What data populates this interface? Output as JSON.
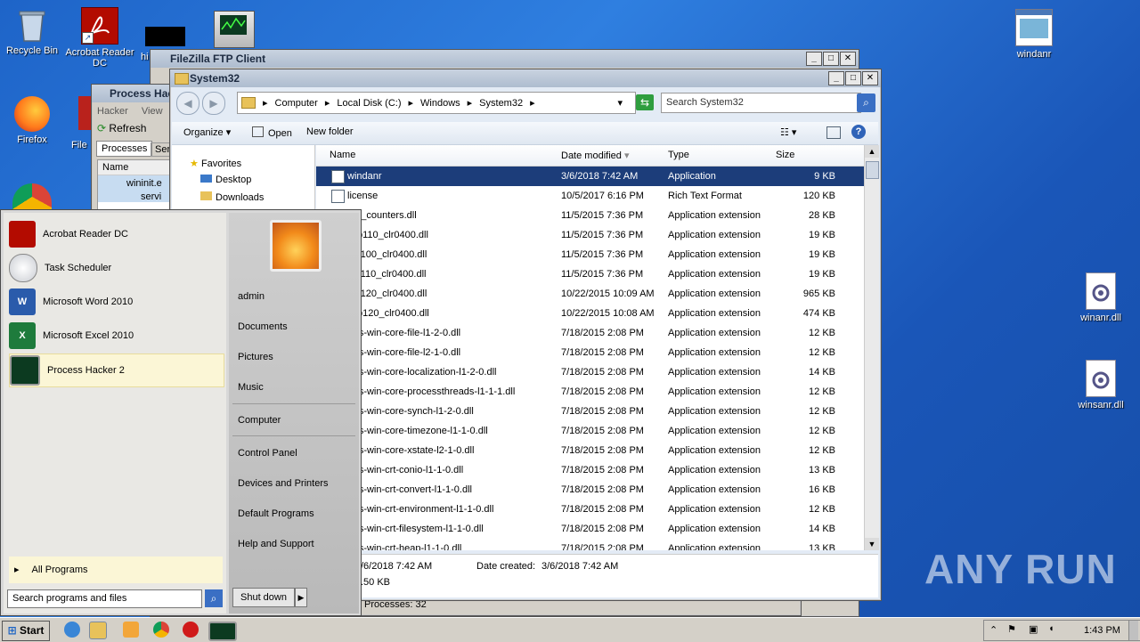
{
  "desktop": {
    "icons": [
      {
        "label": "Recycle Bin"
      },
      {
        "label": "Acrobat Reader DC"
      },
      {
        "label": "Firefox"
      },
      {
        "label": "windanr"
      },
      {
        "label": "winanr.dll"
      },
      {
        "label": "winsanr.dll"
      }
    ],
    "partial_labels": {
      "hi": "hi",
      "filez": "File"
    }
  },
  "filezilla": {
    "title": "FileZilla FTP Client"
  },
  "process_hacker": {
    "title": "Process Hac",
    "menu": [
      "Hacker",
      "View"
    ],
    "refresh": "Refresh",
    "tabs": [
      "Processes",
      "Ser"
    ],
    "column": "Name",
    "tree": [
      "wininit.e",
      "servi"
    ],
    "status": "Processes: 32"
  },
  "explorer": {
    "title": "System32",
    "breadcrumb": [
      "Computer",
      "Local Disk (C:)",
      "Windows",
      "System32"
    ],
    "search_placeholder": "Search System32",
    "commands": {
      "organize": "Organize",
      "open": "Open",
      "new_folder": "New folder"
    },
    "nav": [
      "Favorites",
      "Desktop",
      "Downloads"
    ],
    "columns": {
      "name": "Name",
      "date": "Date modified",
      "type": "Type",
      "size": "Size"
    },
    "files": [
      {
        "name": "windanr",
        "date": "3/6/2018 7:42 AM",
        "type": "Application",
        "size": "9 KB"
      },
      {
        "name": "license",
        "date": "10/5/2017 6:16 PM",
        "type": "Rich Text Format",
        "size": "120 KB"
      },
      {
        "name": "net_counters.dll",
        "date": "11/5/2015 7:36 PM",
        "type": "Application extension",
        "size": "28 KB"
      },
      {
        "name": "vcp110_clr0400.dll",
        "date": "11/5/2015 7:36 PM",
        "type": "Application extension",
        "size": "19 KB"
      },
      {
        "name": "vcr100_clr0400.dll",
        "date": "11/5/2015 7:36 PM",
        "type": "Application extension",
        "size": "19 KB"
      },
      {
        "name": "vcr110_clr0400.dll",
        "date": "11/5/2015 7:36 PM",
        "type": "Application extension",
        "size": "19 KB"
      },
      {
        "name": "vcr120_clr0400.dll",
        "date": "10/22/2015 10:09 AM",
        "type": "Application extension",
        "size": "965 KB"
      },
      {
        "name": "vcp120_clr0400.dll",
        "date": "10/22/2015 10:08 AM",
        "type": "Application extension",
        "size": "474 KB"
      },
      {
        "name": "-ms-win-core-file-l1-2-0.dll",
        "date": "7/18/2015 2:08 PM",
        "type": "Application extension",
        "size": "12 KB"
      },
      {
        "name": "-ms-win-core-file-l2-1-0.dll",
        "date": "7/18/2015 2:08 PM",
        "type": "Application extension",
        "size": "12 KB"
      },
      {
        "name": "-ms-win-core-localization-l1-2-0.dll",
        "date": "7/18/2015 2:08 PM",
        "type": "Application extension",
        "size": "14 KB"
      },
      {
        "name": "-ms-win-core-processthreads-l1-1-1.dll",
        "date": "7/18/2015 2:08 PM",
        "type": "Application extension",
        "size": "12 KB"
      },
      {
        "name": "-ms-win-core-synch-l1-2-0.dll",
        "date": "7/18/2015 2:08 PM",
        "type": "Application extension",
        "size": "12 KB"
      },
      {
        "name": "-ms-win-core-timezone-l1-1-0.dll",
        "date": "7/18/2015 2:08 PM",
        "type": "Application extension",
        "size": "12 KB"
      },
      {
        "name": "-ms-win-core-xstate-l2-1-0.dll",
        "date": "7/18/2015 2:08 PM",
        "type": "Application extension",
        "size": "12 KB"
      },
      {
        "name": "-ms-win-crt-conio-l1-1-0.dll",
        "date": "7/18/2015 2:08 PM",
        "type": "Application extension",
        "size": "13 KB"
      },
      {
        "name": "-ms-win-crt-convert-l1-1-0.dll",
        "date": "7/18/2015 2:08 PM",
        "type": "Application extension",
        "size": "16 KB"
      },
      {
        "name": "-ms-win-crt-environment-l1-1-0.dll",
        "date": "7/18/2015 2:08 PM",
        "type": "Application extension",
        "size": "12 KB"
      },
      {
        "name": "-ms-win-crt-filesystem-l1-1-0.dll",
        "date": "7/18/2015 2:08 PM",
        "type": "Application extension",
        "size": "14 KB"
      },
      {
        "name": "-ms-win-crt-heap-l1-1-0.dll",
        "date": "7/18/2015 2:08 PM",
        "type": "Application extension",
        "size": "13 KB"
      }
    ],
    "details": {
      "modified": "/6/2018 7:42 AM",
      "created_label": "Date created:",
      "created": "3/6/2018 7:42 AM",
      "size": ".50 KB"
    }
  },
  "start_menu": {
    "programs": [
      "Acrobat Reader DC",
      "Task Scheduler",
      "Microsoft Word 2010",
      "Microsoft Excel 2010",
      "Process Hacker 2"
    ],
    "all_programs": "All Programs",
    "search_placeholder": "Search programs and files",
    "right": [
      "admin",
      "Documents",
      "Pictures",
      "Music",
      "Computer",
      "Control Panel",
      "Devices and Printers",
      "Default Programs",
      "Help and Support"
    ],
    "shutdown": "Shut down"
  },
  "taskbar": {
    "start": "Start",
    "clock": "1:43 PM"
  },
  "watermark": "ANY RUN"
}
